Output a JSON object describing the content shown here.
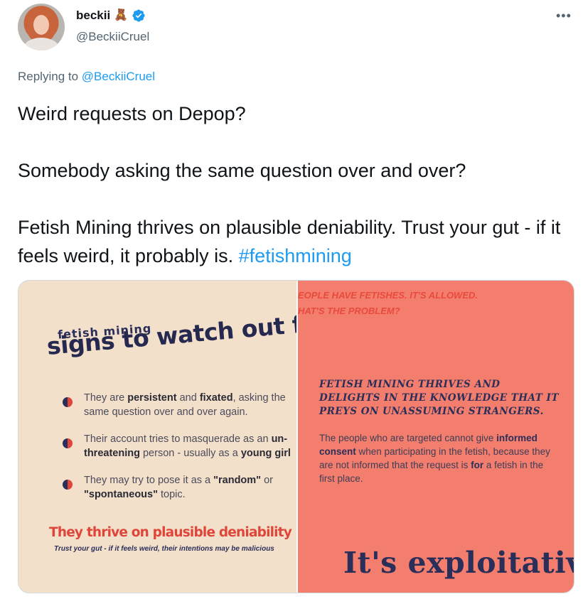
{
  "author": {
    "display_name": "beckii",
    "emoji": "🧸",
    "verified": true,
    "handle": "@BeckiiCruel"
  },
  "more_icon": "more-horizontal-icon",
  "reply": {
    "prefix": "Replying to",
    "target": "@BeckiiCruel"
  },
  "tweet": {
    "line1": "Weird requests on Depop?",
    "line2": "Somebody asking the same question over and over?",
    "line3": "Fetish Mining thrives on plausible deniability. Trust your gut - if it feels weird, it probably is.",
    "hashtag": "#fetishmining"
  },
  "media": {
    "left": {
      "subtitle": "fetish mining",
      "title": "signs to watch out for",
      "signs": [
        {
          "pre": "They are ",
          "b1": "persistent",
          "mid": " and ",
          "b2": "fixated",
          "post": ", asking the same question over and over again."
        },
        {
          "pre": "Their account tries to masquerade as an ",
          "b1": "un-threatening",
          "mid": " person - usually as a ",
          "b2": "young girl",
          "post": ""
        },
        {
          "pre": "They may try to pose it as a ",
          "b1": "\"random\"",
          "mid": " or ",
          "b2": "\"spontaneous\"",
          "post": " topic."
        }
      ],
      "thrive": "They thrive on plausible deniability",
      "trust": "Trust your gut - if it feels weird, their intentions may be malicious"
    },
    "right": {
      "top_line1": "EOPLE HAVE FETISHES. IT'S ALLOWED.",
      "top_line2": "HAT'S THE PROBLEM?",
      "heading": "FETISH MINING THRIVES AND DELIGHTS IN THE KNOWLEDGE THAT IT PREYS ON UNASSUMING STRANGERS.",
      "body_pre": "The people who are targeted cannot give ",
      "body_b1": "informed consent",
      "body_mid": " when participating in the fetish, because they are not informed that the request is ",
      "body_b2": "for",
      "body_post": " a fetish in the first place.",
      "big": "It's exploitative"
    }
  },
  "colors": {
    "link": "#1d9bf0",
    "panel_left": "#f3e0cb",
    "panel_right": "#f47e6e",
    "navy": "#2a2f5a",
    "red": "#e0453a"
  }
}
